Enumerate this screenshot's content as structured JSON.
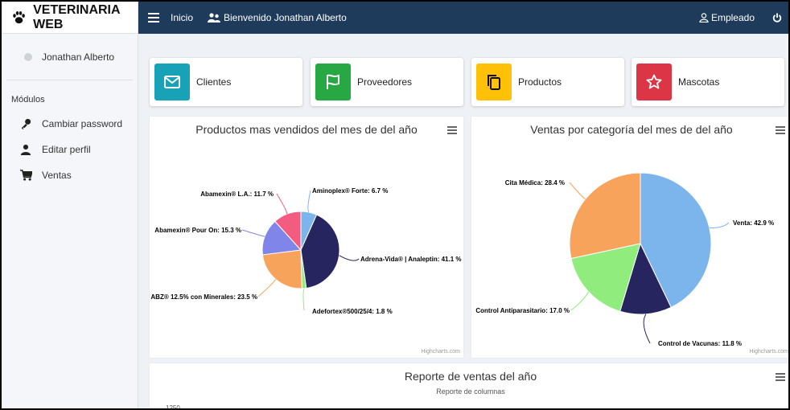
{
  "brand": {
    "name": "VETERINARIA WEB"
  },
  "sidebar": {
    "user_name": "Jonathan Alberto",
    "section_label": "Módulos",
    "items": [
      {
        "label": "Cambiar password",
        "icon": "key-icon"
      },
      {
        "label": "Editar perfil",
        "icon": "user-icon"
      },
      {
        "label": "Ventas",
        "icon": "cart-icon"
      }
    ]
  },
  "topbar": {
    "home_label": "Inicio",
    "welcome_label": "Bienvenido Jonathan Alberto",
    "role_label": "Empleado",
    "bg_color": "#1f3b5b"
  },
  "cards": [
    {
      "label": "Clientes",
      "color": "#17a2b8",
      "icon": "envelope-icon"
    },
    {
      "label": "Proveedores",
      "color": "#28a745",
      "icon": "flag-icon"
    },
    {
      "label": "Productos",
      "color": "#ffc107",
      "icon": "copy-icon"
    },
    {
      "label": "Mascotas",
      "color": "#dc3545",
      "icon": "star-icon"
    }
  ],
  "chart_data": [
    {
      "type": "pie",
      "title": "Productos mas vendidos del mes de del año",
      "credit": "Highcharts.com",
      "slices": [
        {
          "name": "Aminoplex® Forte",
          "value": 6.7,
          "label": "Aminoplex® Forte: 6.7 %",
          "color": "#7cb5ec"
        },
        {
          "name": "Adrena-Vida® | Analeptin",
          "value": 41.1,
          "label": "Adrena-Vida® | Analeptin: 41.1 %",
          "color": "#262560"
        },
        {
          "name": "Adefortex®500/25/4",
          "value": 1.8,
          "label": "Adefortex®500/25/4: 1.8 %",
          "color": "#90ed7d"
        },
        {
          "name": "ABZ® 12.5% con Minerales",
          "value": 23.5,
          "label": "ABZ® 12.5% con Minerales: 23.5 %",
          "color": "#f7a35c"
        },
        {
          "name": "Abamexin® Pour On",
          "value": 15.3,
          "label": "Abamexin® Pour On: 15.3 %",
          "color": "#8085e9"
        },
        {
          "name": "Abamexin® L.A.",
          "value": 11.7,
          "label": "Abamexin® L.A.: 11.7 %",
          "color": "#f15c80"
        }
      ]
    },
    {
      "type": "pie",
      "title": "Ventas por categoría del mes de del año",
      "credit": "Highcharts.com",
      "slices": [
        {
          "name": "Venta",
          "value": 42.9,
          "label": "Venta: 42.9 %",
          "color": "#7cb5ec"
        },
        {
          "name": "Control de Vacunas",
          "value": 11.8,
          "label": "Control de Vacunas: 11.8 %",
          "color": "#262560"
        },
        {
          "name": "Control Antiparasitario",
          "value": 17.0,
          "label": "Control Antiparasitario: 17.0 %",
          "color": "#90ed7d"
        },
        {
          "name": "Cita Médica",
          "value": 28.4,
          "label": "Cita Médica: 28.4 %",
          "color": "#f7a35c"
        }
      ]
    },
    {
      "type": "bar",
      "title": "Reporte de ventas del año",
      "subtitle": "Reporte de columnas",
      "y_ticks": [
        "1250"
      ]
    }
  ]
}
